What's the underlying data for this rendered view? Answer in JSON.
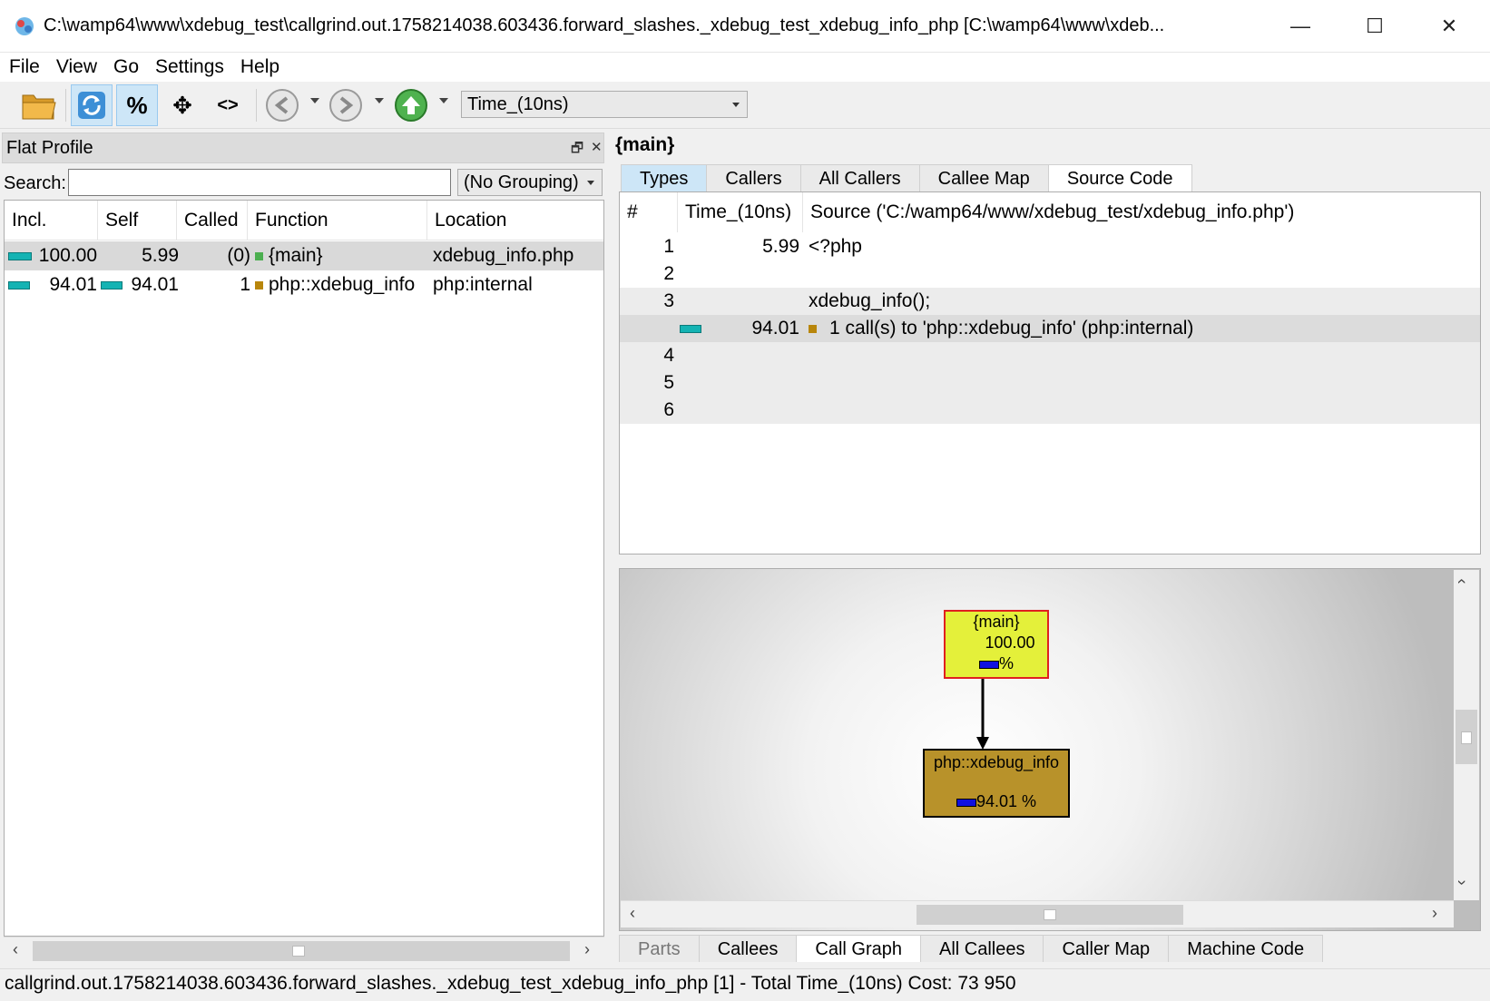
{
  "window": {
    "title": "C:\\wamp64\\www\\xdebug_test\\callgrind.out.1758214038.603436.forward_slashes._xdebug_test_xdebug_info_php [C:\\wamp64\\www\\xdeb...",
    "minimize_glyph": "—",
    "maximize_glyph": "☐",
    "close_glyph": "✕"
  },
  "menu": [
    "File",
    "View",
    "Go",
    "Settings",
    "Help"
  ],
  "toolbar": {
    "percent_label": "%",
    "move_label": "✥",
    "code_label": "<>",
    "event_type": "Time_(10ns)"
  },
  "flat_profile": {
    "title": "Flat Profile",
    "float_glyph": "🗗",
    "close_glyph": "✕",
    "search_label": "Search:",
    "search_value": "",
    "grouping": "(No Grouping)",
    "columns": [
      "Incl.",
      "Self",
      "Called",
      "Function",
      "Location"
    ],
    "rows": [
      {
        "incl": "100.00",
        "self": "5.99",
        "called": "(0)",
        "function": "{main}",
        "location": "xdebug_info.php",
        "incl_fraction": 1.0,
        "self_fraction": 0.0,
        "color": "#4caf50"
      },
      {
        "incl": "94.01",
        "self": "94.01",
        "called": "1",
        "function": "php::xdebug_info",
        "location": "php:internal",
        "incl_fraction": 0.94,
        "self_fraction": 0.94,
        "color": "#b8860b"
      }
    ]
  },
  "detail": {
    "function_title": "{main}",
    "top_tabs": [
      "Types",
      "Callers",
      "All Callers",
      "Callee Map",
      "Source Code"
    ],
    "source": {
      "col_line": "#",
      "col_time": "Time_(10ns)",
      "col_source": "Source ('C:/wamp64/www/xdebug_test/xdebug_info.php')",
      "lines": [
        {
          "line": "1",
          "time": "5.99",
          "text": "<?php",
          "grey": false,
          "call": false
        },
        {
          "line": "2",
          "time": "",
          "text": "",
          "grey": false,
          "call": false
        },
        {
          "line": "3",
          "time": "",
          "text": "xdebug_info();",
          "grey": true,
          "call": false
        },
        {
          "line": "",
          "time": "94.01",
          "text": "1 call(s) to 'php::xdebug_info' (php:internal)",
          "grey": true,
          "call": true
        },
        {
          "line": "4",
          "time": "",
          "text": "",
          "grey": true,
          "call": false
        },
        {
          "line": "5",
          "time": "",
          "text": "",
          "grey": true,
          "call": false
        },
        {
          "line": "6",
          "time": "",
          "text": "",
          "grey": true,
          "call": false
        }
      ]
    },
    "graph": {
      "main_node": {
        "name": "{main}",
        "value": "100.00",
        "pct": "%"
      },
      "child_node": {
        "name": "php::xdebug_info",
        "value": "94.01 %"
      }
    },
    "bottom_tabs": [
      "Parts",
      "Callees",
      "Call Graph",
      "All Callees",
      "Caller Map",
      "Machine Code"
    ]
  },
  "status": "callgrind.out.1758214038.603436.forward_slashes._xdebug_test_xdebug_info_php [1] - Total Time_(10ns) Cost: 73 950"
}
